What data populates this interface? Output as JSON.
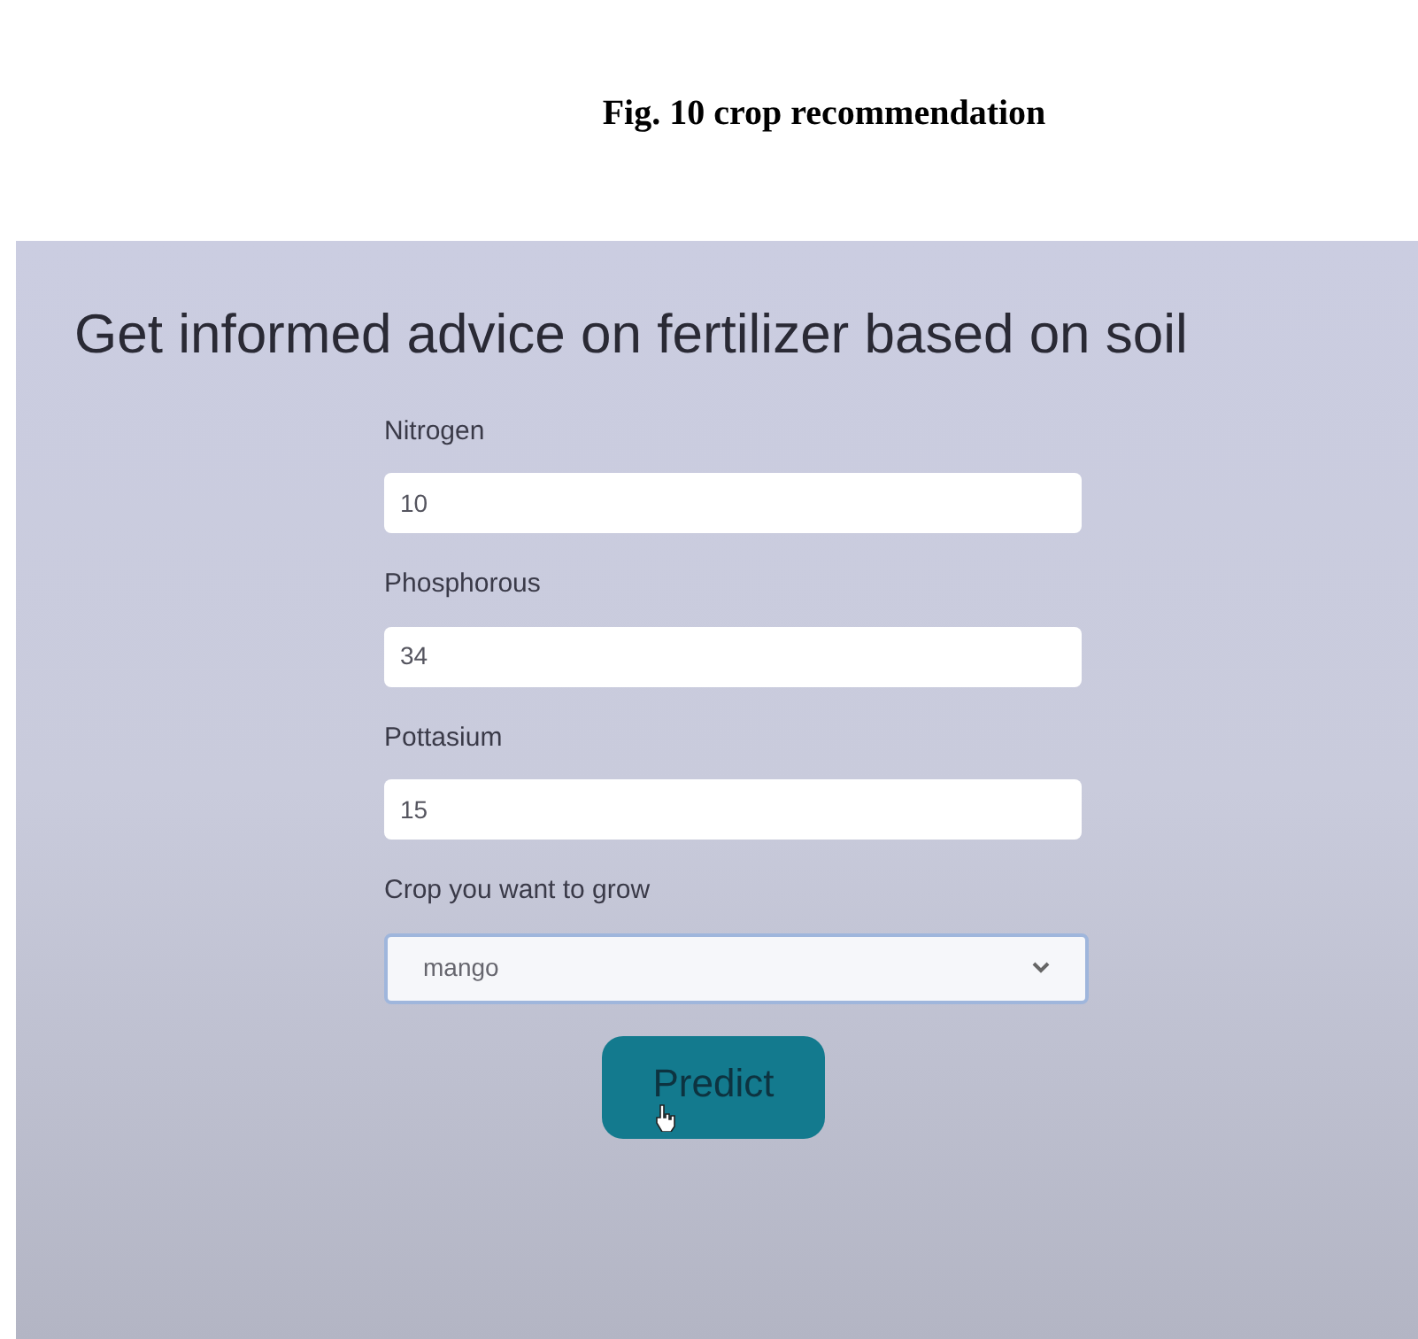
{
  "caption": "Fig. 10 crop recommendation",
  "heading": "Get informed advice on fertilizer based on soil",
  "fields": [
    {
      "kind": "input",
      "label": "Nitrogen",
      "value": "10"
    },
    {
      "kind": "input",
      "label": "Phosphorous",
      "value": "34"
    },
    {
      "kind": "input",
      "label": "Pottasium",
      "value": "15"
    },
    {
      "kind": "select",
      "label": "Crop you want to grow",
      "value": "mango"
    }
  ],
  "button": "Predict"
}
